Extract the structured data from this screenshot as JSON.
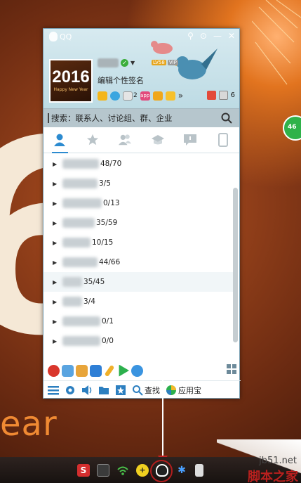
{
  "window": {
    "title": "QQ",
    "controls": [
      "pin",
      "settings",
      "minimize",
      "close"
    ]
  },
  "profile": {
    "avatar_year": "2016",
    "avatar_sub": "Happy New Year",
    "signature": "编辑个性签名",
    "lv_badge": "LV58",
    "vip_badge": "VIP",
    "mail_count": "2",
    "app_label": "app",
    "skin_count": "6"
  },
  "search": {
    "placeholder": "搜索：联系人、讨论组、群、企业"
  },
  "tabs": [
    {
      "name": "contacts",
      "icon": "person-icon",
      "active": true
    },
    {
      "name": "favorites",
      "icon": "star-icon",
      "active": false
    },
    {
      "name": "groups",
      "icon": "group-icon",
      "active": false
    },
    {
      "name": "qzone",
      "icon": "qzone-icon",
      "active": false
    },
    {
      "name": "messages",
      "icon": "chat-bubble-icon",
      "active": false
    },
    {
      "name": "phone",
      "icon": "phone-icon",
      "active": false
    }
  ],
  "groups": [
    {
      "count": "48/70"
    },
    {
      "count": "3/5"
    },
    {
      "count": "0/13"
    },
    {
      "count": "35/59"
    },
    {
      "count": "10/15"
    },
    {
      "count": "44/66"
    },
    {
      "count": "35/45"
    },
    {
      "count": "3/4"
    },
    {
      "count": "0/1"
    },
    {
      "count": "0/0"
    }
  ],
  "bottom_bar": {
    "find_label": "查找",
    "appstore_label": "应用宝"
  },
  "desktop": {
    "big_digit": "6",
    "year_text": "ear",
    "side_badge": "46"
  },
  "watermark": {
    "url": "jb51.net",
    "text": "脚本之家"
  },
  "colors": {
    "accent": "#2c8bd0",
    "search_bg": "#b6c6cd",
    "header_bg": "#c9e2ea"
  }
}
